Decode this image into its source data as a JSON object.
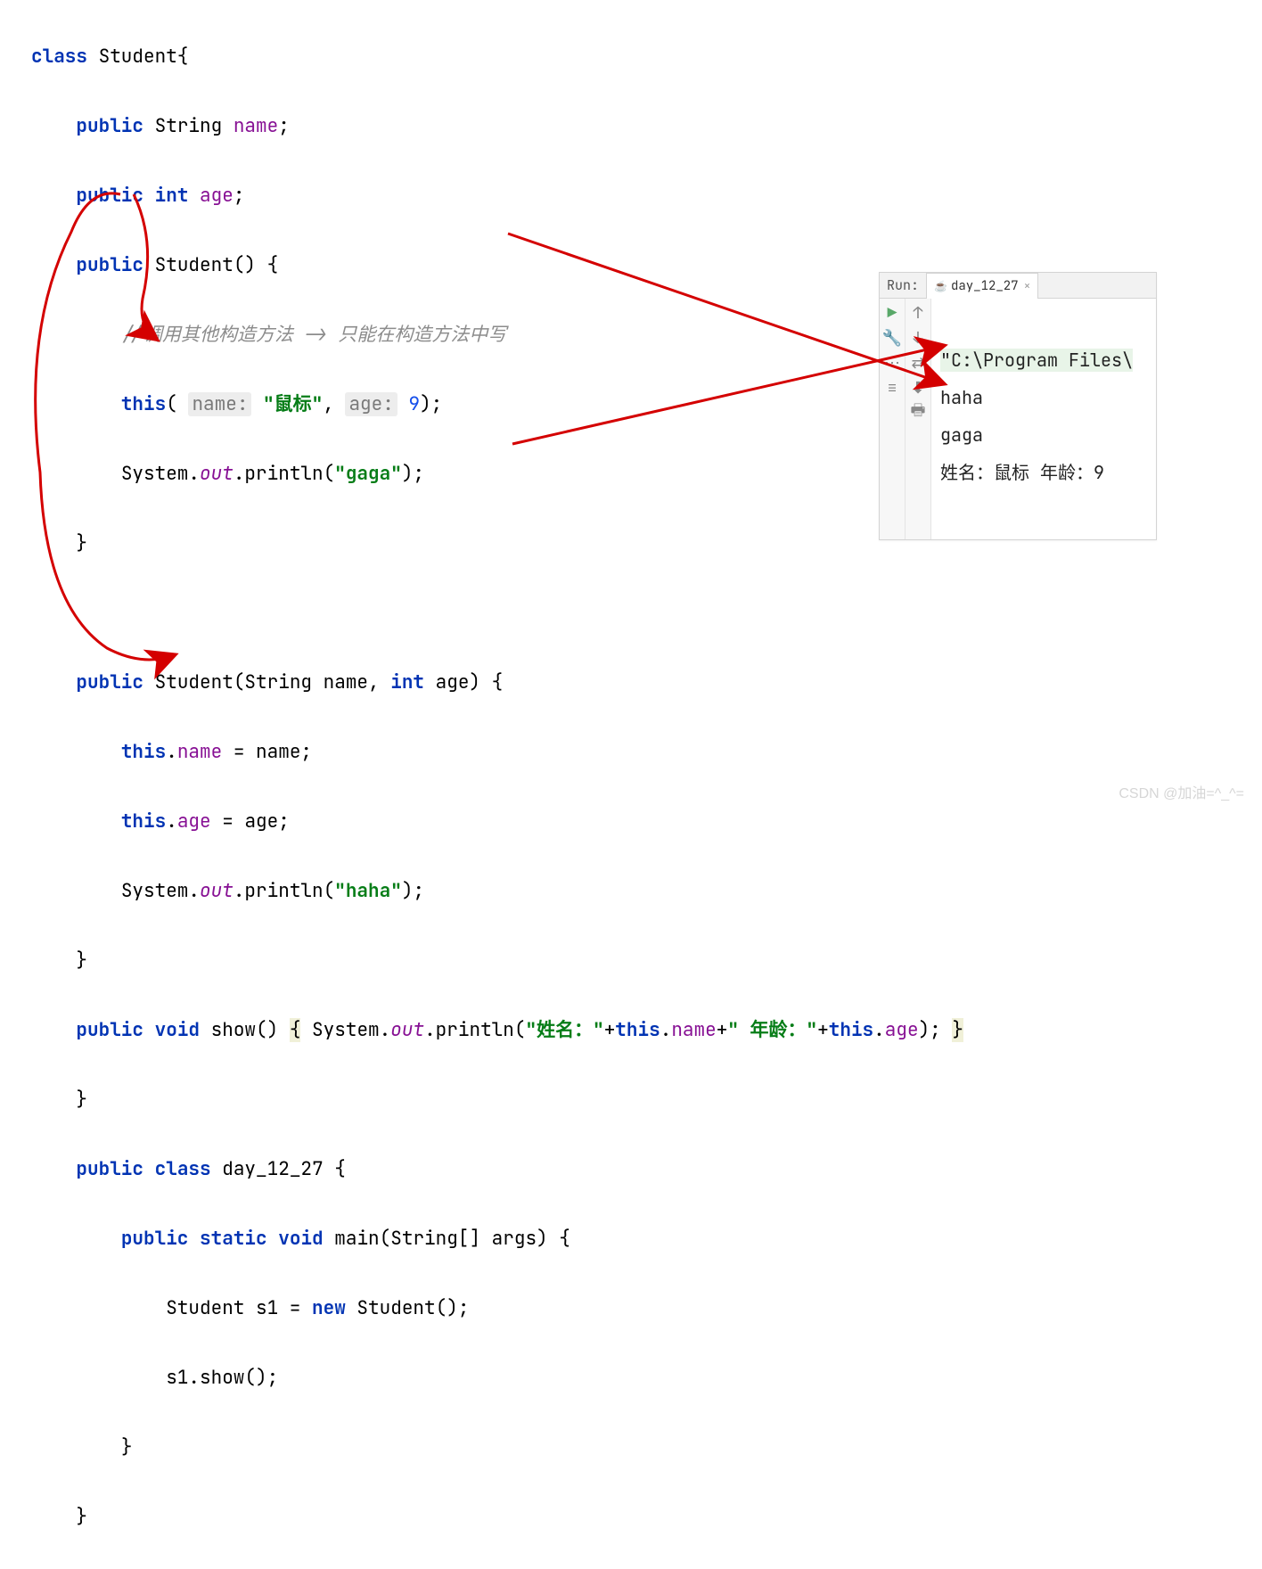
{
  "code": {
    "l1_class": "class",
    "l1_name": " Student{",
    "l2_public": "public",
    "l2_rest": " String ",
    "l2_field": "name",
    "l2_semi": ";",
    "l3_public": "public",
    "l3_rest": " ",
    "l3_int": "int",
    "l3_sp": " ",
    "l3_field": "age",
    "l3_semi": ";",
    "l4_public": "public",
    "l4_rest": " Student() {",
    "l5_comment": "//调用其他构造方法 -> 只能在构造方法中写",
    "l6_this": "this",
    "l6_open": "(",
    "l6_hint1": "name:",
    "l6_sp1": " ",
    "l6_str1": "\"鼠标\"",
    "l6_comma": ", ",
    "l6_hint2": "age:",
    "l6_sp2": " ",
    "l6_num": "9",
    "l6_close": ");",
    "l7_pre": "System.",
    "l7_out": "out",
    "l7_mid": ".println(",
    "l7_str": "\"gaga\"",
    "l7_end": ");",
    "l8": "}",
    "l9_public": "public",
    "l9_mid": " Student(String name, ",
    "l9_int": "int",
    "l9_end": " age) {",
    "l10_this": "this",
    "l10_dot": ".",
    "l10_field": "name",
    "l10_rest": " = name;",
    "l11_this": "this",
    "l11_dot": ".",
    "l11_field": "age",
    "l11_rest": " = age;",
    "l12_pre": "System.",
    "l12_out": "out",
    "l12_mid": ".println(",
    "l12_str": "\"haha\"",
    "l12_end": ");",
    "l13": "}",
    "l14_public": "public",
    "l14_sp": " ",
    "l14_void": "void",
    "l14_show": " show() ",
    "l14_brace1": "{",
    "l14_pre": " System.",
    "l14_out": "out",
    "l14_mid": ".println(",
    "l14_str1": "\"姓名：\"",
    "l14_plus1": "+",
    "l14_this1": "this",
    "l14_d1": ".",
    "l14_f1": "name",
    "l14_plus2": "+",
    "l14_str2": "\" 年龄：\"",
    "l14_plus3": "+",
    "l14_this2": "this",
    "l14_d2": ".",
    "l14_f2": "age",
    "l14_end": "); ",
    "l14_brace2": "}",
    "l15": "}",
    "l16_public": "public",
    "l16_sp": " ",
    "l16_class": "class",
    "l16_rest": " day_12_27 {",
    "l17_public": "public",
    "l17_sp": " ",
    "l17_static": "static",
    "l17_sp2": " ",
    "l17_void": "void",
    "l17_rest": " main(String[] args) {",
    "l18_pre": "Student s1 = ",
    "l18_new": "new",
    "l18_rest": " Student();",
    "l19": "s1.show();",
    "l20": "}",
    "l21": "}"
  },
  "run": {
    "label": "Run:",
    "tab": "day_12_27",
    "cmdline": "\"C:\\Program Files\\",
    "out1": "haha",
    "out2": "gaga",
    "out3": "姓名：鼠标 年龄：9"
  },
  "watermark": "CSDN @加油=^_^="
}
